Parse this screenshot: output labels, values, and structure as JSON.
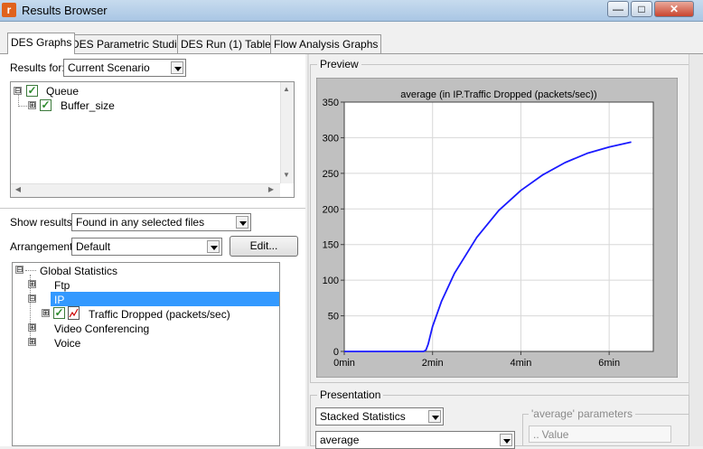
{
  "window": {
    "title": "Results Browser",
    "app_icon_letter": "r",
    "minimize_icon": "minimize-icon",
    "maximize_icon": "maximize-icon",
    "close_icon": "close-icon"
  },
  "tabs": [
    {
      "label": "DES Graphs",
      "active": true
    },
    {
      "label": "DES Parametric Studies",
      "active": false
    },
    {
      "label": "DES Run (1) Tables",
      "active": false
    },
    {
      "label": "Flow Analysis Graphs",
      "active": false
    }
  ],
  "results_for": {
    "label": "Results for:",
    "value": "Current Scenario"
  },
  "scenario_tree": [
    {
      "label": "Queue",
      "checked": true,
      "expander": "⊟"
    },
    {
      "label": "Buffer_size",
      "checked": true,
      "expander": "⊞"
    }
  ],
  "show_results": {
    "label": "Show results:",
    "value": "Found in any selected files"
  },
  "arrangement": {
    "label": "Arrangement:",
    "value": "Default",
    "edit_button": "Edit..."
  },
  "stats_tree": [
    {
      "label": "Global Statistics",
      "expander": "⊟"
    },
    {
      "label": "Ftp",
      "expander": "⊞"
    },
    {
      "label": "IP",
      "expander": "⊟",
      "selected": true
    },
    {
      "label": "Traffic Dropped (packets/sec)",
      "expander": "⊞",
      "checked": true
    },
    {
      "label": "Video Conferencing",
      "expander": "⊞"
    },
    {
      "label": "Voice",
      "expander": "⊞"
    }
  ],
  "preview": {
    "title": "Preview"
  },
  "chart_data": {
    "type": "line",
    "title": "average (in IP.Traffic Dropped (packets/sec))",
    "xlabel": "",
    "ylabel": "",
    "x_unit": "min",
    "xlim": [
      0,
      7
    ],
    "ylim": [
      0,
      350
    ],
    "x_ticks": [
      0,
      2,
      4,
      6
    ],
    "x_tick_labels": [
      "0min",
      "2min",
      "4min",
      "6min"
    ],
    "y_ticks": [
      0,
      50,
      100,
      150,
      200,
      250,
      300,
      350
    ],
    "y_tick_labels": [
      "0",
      "50",
      "100",
      "150",
      "200",
      "250",
      "300",
      "350"
    ],
    "grid": true,
    "series": [
      {
        "color": "#1a1aff",
        "x": [
          0,
          1.8,
          1.85,
          1.9,
          2.0,
          2.2,
          2.5,
          3.0,
          3.5,
          4.0,
          4.5,
          5.0,
          5.5,
          6.0,
          6.5
        ],
        "y": [
          0,
          0,
          2,
          10,
          35,
          70,
          110,
          160,
          198,
          226,
          248,
          265,
          278,
          287,
          294
        ]
      }
    ]
  },
  "presentation": {
    "title": "Presentation",
    "stack_value": "Stacked Statistics",
    "filter_value": "average",
    "params_title": "'average' parameters",
    "params_column": "Value"
  }
}
